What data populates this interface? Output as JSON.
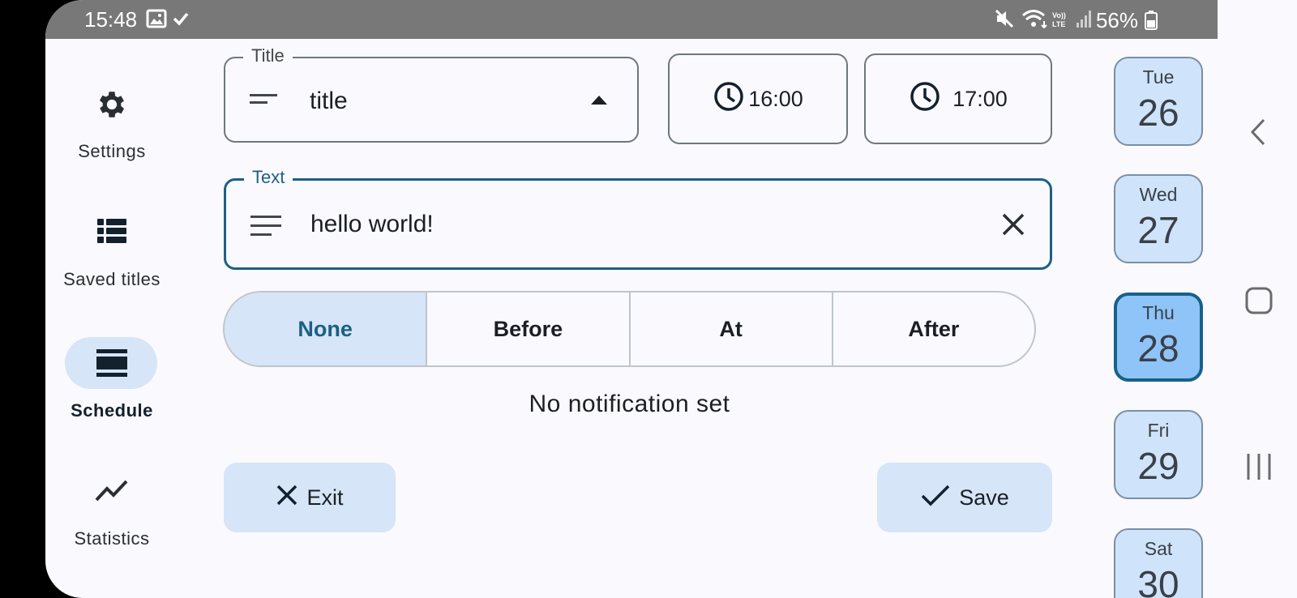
{
  "status_bar": {
    "time": "15:48",
    "battery": "56%"
  },
  "rail": {
    "items": [
      {
        "label": "Settings",
        "icon": "gear-icon"
      },
      {
        "label": "Saved titles",
        "icon": "list-icon"
      },
      {
        "label": "Schedule",
        "icon": "schedule-icon",
        "selected": true
      },
      {
        "label": "Statistics",
        "icon": "trend-icon"
      }
    ]
  },
  "form": {
    "title_field": {
      "label": "Title",
      "value": "title"
    },
    "start_time": "16:00",
    "end_time": "17:00",
    "text_field": {
      "label": "Text",
      "value": "hello world!"
    },
    "notification_options": [
      "None",
      "Before",
      "At",
      "After"
    ],
    "notification_selected": "None",
    "notification_status": "No notification set",
    "exit_label": "Exit",
    "save_label": "Save"
  },
  "days": [
    {
      "name": "Tue",
      "date": "26"
    },
    {
      "name": "Wed",
      "date": "27"
    },
    {
      "name": "Thu",
      "date": "28",
      "selected": true
    },
    {
      "name": "Fri",
      "date": "29"
    },
    {
      "name": "Sat",
      "date": "30"
    }
  ],
  "colors": {
    "accent": "#1d5f86",
    "selected_bg": "#d6e5f7",
    "day_bg": "#cfe4fb",
    "day_selected_bg": "#8fc4f8"
  }
}
